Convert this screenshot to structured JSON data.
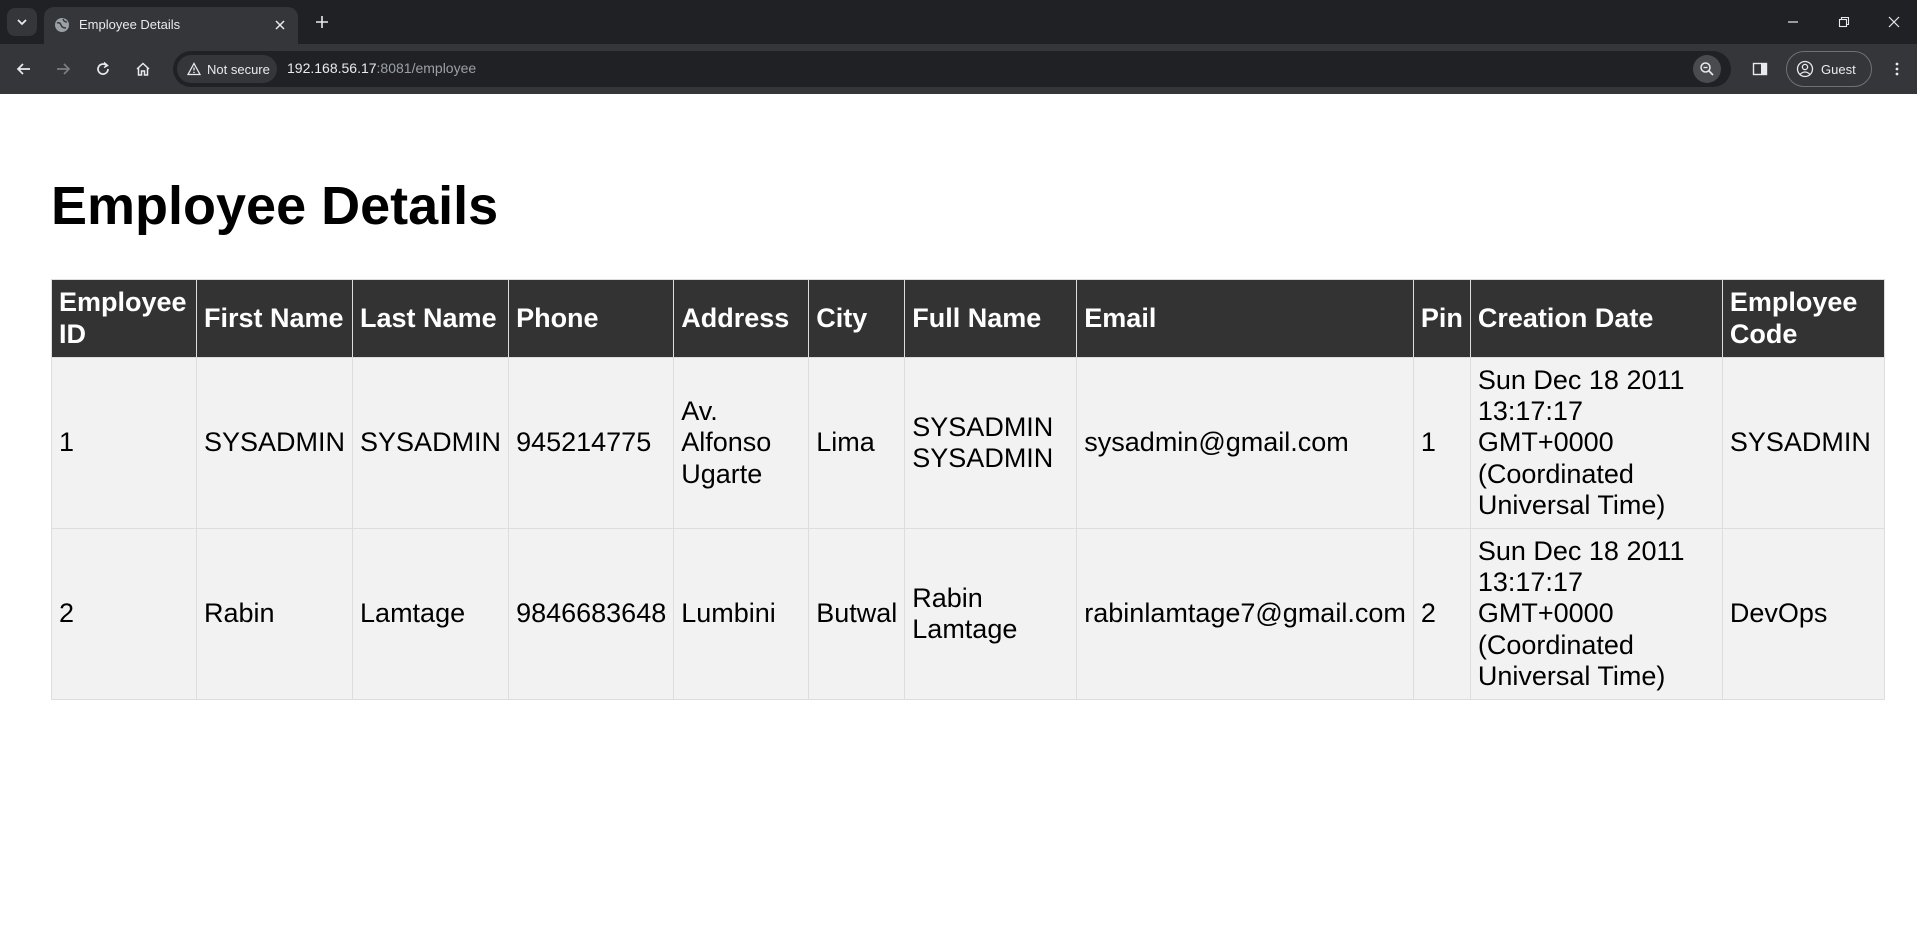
{
  "browser": {
    "tab_title": "Employee Details",
    "security_label": "Not secure",
    "url_host": "192.168.56.17",
    "url_path": ":8081/employee",
    "profile_label": "Guest"
  },
  "page": {
    "title": "Employee Details"
  },
  "table": {
    "headers": [
      "Employee ID",
      "First Name",
      "Last Name",
      "Phone",
      "Address",
      "City",
      "Full Name",
      "Email",
      "Pin",
      "Creation Date",
      "Employee Code"
    ],
    "rows": [
      {
        "id": "1",
        "first_name": "SYSADMIN",
        "last_name": "SYSADMIN",
        "phone": "945214775",
        "address": "Av. Alfonso Ugarte",
        "city": "Lima",
        "full_name": "SYSADMIN SYSADMIN",
        "email": "sysadmin@gmail.com",
        "pin": "1",
        "creation_date": "Sun Dec 18 2011 13:17:17 GMT+0000 (Coordinated Universal Time)",
        "employee_code": "SYSADMIN"
      },
      {
        "id": "2",
        "first_name": "Rabin",
        "last_name": "Lamtage",
        "phone": "9846683648",
        "address": "Lumbini",
        "city": "Butwal",
        "full_name": "Rabin Lamtage",
        "email": "rabinlamtage7@gmail.com",
        "pin": "2",
        "creation_date": "Sun Dec 18 2011 13:17:17 GMT+0000 (Coordinated Universal Time)",
        "employee_code": "DevOps"
      }
    ]
  }
}
